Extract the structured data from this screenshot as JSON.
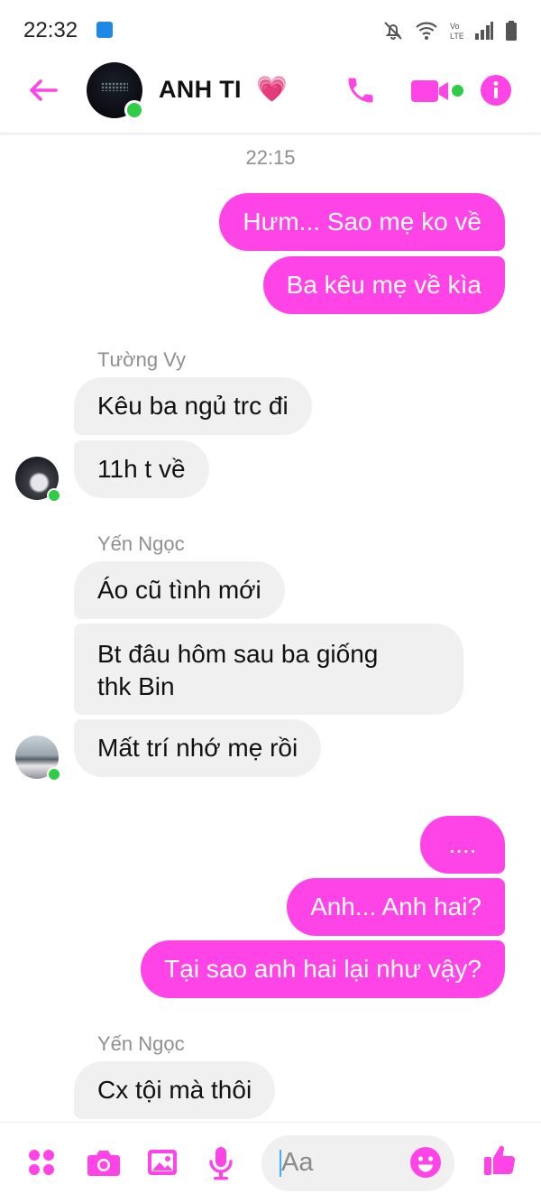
{
  "status_bar": {
    "time": "22:32",
    "app_badge": "NOVEL TOON",
    "icons": [
      "mute-bell-icon",
      "wifi-icon",
      "volte-icon",
      "signal-icon",
      "battery-icon"
    ]
  },
  "header": {
    "contact_name": "ANH TI",
    "heart": "💗",
    "online": true
  },
  "colors": {
    "accent": "#ff44e7",
    "incoming_bubble": "#f0f0f0",
    "online": "#31cc46"
  },
  "messages": {
    "timestamp": "22:15",
    "out_1": "Hưm... Sao mẹ ko về",
    "out_2": "Ba kêu mẹ về kìa",
    "sender_1": "Tường Vy",
    "in_1": "Kêu ba ngủ trc đi",
    "in_2": "11h t về",
    "sender_2": "Yến Ngọc",
    "in_3": "Áo cũ tình mới",
    "in_4_line1": "Bt đâu hôm sau ba giống",
    "in_4_line2": "thk Bin",
    "in_5": "Mất trí nhớ mẹ rồi",
    "out_3": "....",
    "out_4": "Anh... Anh hai?",
    "out_5": "Tại sao anh hai lại như vậy?",
    "sender_3": "Yến Ngọc",
    "in_6": "Cx tội mà thôi"
  },
  "composer": {
    "placeholder": "Aa",
    "icons": [
      "apps-icon",
      "camera-icon",
      "gallery-icon",
      "microphone-icon",
      "emoji-icon",
      "thumbs-up-icon"
    ]
  }
}
